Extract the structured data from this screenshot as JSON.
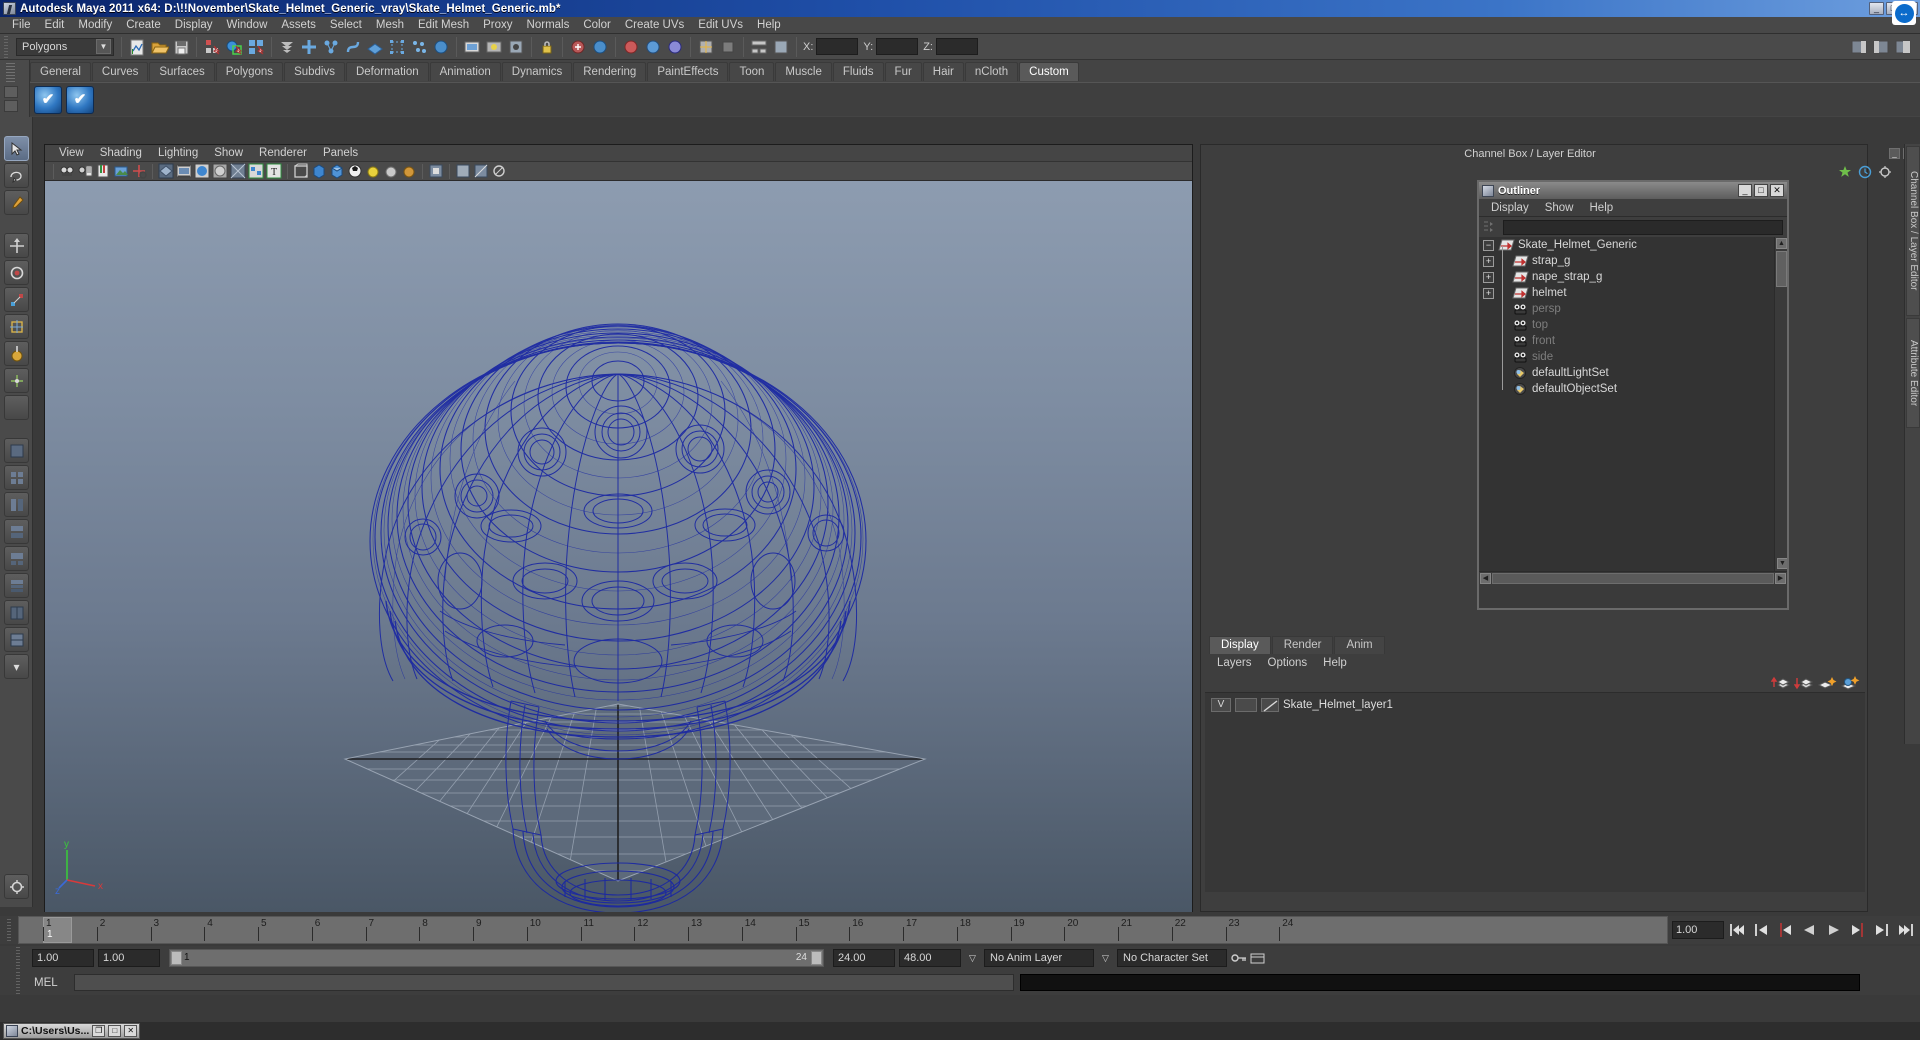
{
  "window": {
    "title": "Autodesk Maya 2011 x64: D:\\!!November\\Skate_Helmet_Generic_vray\\Skate_Helmet_Generic.mb*",
    "min_label": "_",
    "max_label": "□",
    "close_label": "✕"
  },
  "menubar": {
    "items": [
      "File",
      "Edit",
      "Modify",
      "Create",
      "Display",
      "Window",
      "Assets",
      "Select",
      "Mesh",
      "Edit Mesh",
      "Proxy",
      "Normals",
      "Color",
      "Create UVs",
      "Edit UVs",
      "Help"
    ]
  },
  "statusline": {
    "selection_mode": "Polygons",
    "x_label": "X:",
    "y_label": "Y:",
    "z_label": "Z:",
    "x_value": "",
    "y_value": "",
    "z_value": ""
  },
  "shelf": {
    "tabs": [
      "General",
      "Curves",
      "Surfaces",
      "Polygons",
      "Subdivs",
      "Deformation",
      "Animation",
      "Dynamics",
      "Rendering",
      "PaintEffects",
      "Toon",
      "Muscle",
      "Fluids",
      "Fur",
      "Hair",
      "nCloth",
      "Custom"
    ],
    "active_tab": "Custom",
    "buttons": [
      "check-blue-1",
      "check-blue-2"
    ]
  },
  "viewport": {
    "menus": [
      "View",
      "Shading",
      "Lighting",
      "Show",
      "Renderer",
      "Panels"
    ],
    "axis": {
      "x": "x",
      "y": "y",
      "z": "z"
    },
    "background_top": "#8d9cb0",
    "background_bottom": "#4c5968",
    "wireframe_color": "#1b2b9e",
    "model_name": "Skate_Helmet_Generic"
  },
  "channelbox": {
    "title": "Channel Box / Layer Editor",
    "vertical_tabs": [
      "Channel Box / Layer Editor",
      "Attribute Editor"
    ]
  },
  "outliner": {
    "title": "Outliner",
    "menus": [
      "Display",
      "Show",
      "Help"
    ],
    "search_value": "",
    "search_placeholder": "",
    "items": [
      {
        "label": "Skate_Helmet_Generic",
        "expander": "−",
        "icon": "transform-icon",
        "depth": 0,
        "dim": false
      },
      {
        "label": "strap_g",
        "expander": "+",
        "icon": "transform-icon",
        "depth": 1,
        "dim": false
      },
      {
        "label": "nape_strap_g",
        "expander": "+",
        "icon": "transform-icon",
        "depth": 1,
        "dim": false
      },
      {
        "label": "helmet",
        "expander": "+",
        "icon": "transform-icon",
        "depth": 1,
        "dim": false
      },
      {
        "label": "persp",
        "expander": "",
        "icon": "camera-icon",
        "depth": 1,
        "dim": true
      },
      {
        "label": "top",
        "expander": "",
        "icon": "camera-icon",
        "depth": 1,
        "dim": true
      },
      {
        "label": "front",
        "expander": "",
        "icon": "camera-icon",
        "depth": 1,
        "dim": true
      },
      {
        "label": "side",
        "expander": "",
        "icon": "camera-icon",
        "depth": 1,
        "dim": true
      },
      {
        "label": "defaultLightSet",
        "expander": "",
        "icon": "set-icon",
        "depth": 1,
        "dim": false
      },
      {
        "label": "defaultObjectSet",
        "expander": "",
        "icon": "set-icon",
        "depth": 1,
        "dim": false
      }
    ],
    "window_buttons": [
      "_",
      "□",
      "✕"
    ]
  },
  "layer_editor": {
    "tabs": [
      "Display",
      "Render",
      "Anim"
    ],
    "active_tab": "Display",
    "menus": [
      "Layers",
      "Options",
      "Help"
    ],
    "toolbar_icons": [
      "move-layer-up-icon",
      "move-layer-down-icon",
      "new-layer-icon",
      "new-layer-from-selected-icon"
    ],
    "layers": [
      {
        "visibility": "V",
        "playback": "",
        "name": "Skate_Helmet_layer1"
      }
    ]
  },
  "timeslider": {
    "current_frame": "1",
    "ticks": [
      "1",
      "2",
      "3",
      "4",
      "5",
      "6",
      "7",
      "8",
      "9",
      "10",
      "11",
      "12",
      "13",
      "14",
      "15",
      "16",
      "17",
      "18",
      "19",
      "20",
      "21",
      "22",
      "23",
      "24"
    ],
    "playback_speed": "1.00",
    "transport_buttons": [
      "go-to-start-icon",
      "step-back-key-icon",
      "step-back-frame-icon",
      "play-backwards-icon",
      "play-forwards-icon",
      "step-forward-frame-icon",
      "step-forward-key-icon",
      "go-to-end-icon"
    ]
  },
  "rangeslider": {
    "anim_start": "1.00",
    "range_start": "1.00",
    "range_bar_start": "1",
    "range_bar_end": "24",
    "range_end": "24.00",
    "anim_end": "48.00",
    "anim_layer": "No Anim Layer",
    "character_set": "No Character Set"
  },
  "commandline": {
    "label": "MEL",
    "input_value": "",
    "output_value": ""
  },
  "taskbar": {
    "items": [
      {
        "label": "C:\\Users\\Us...",
        "buttons": [
          "❐",
          "□",
          "✕"
        ]
      }
    ],
    "tray_icon": "teamviewer-icon"
  }
}
